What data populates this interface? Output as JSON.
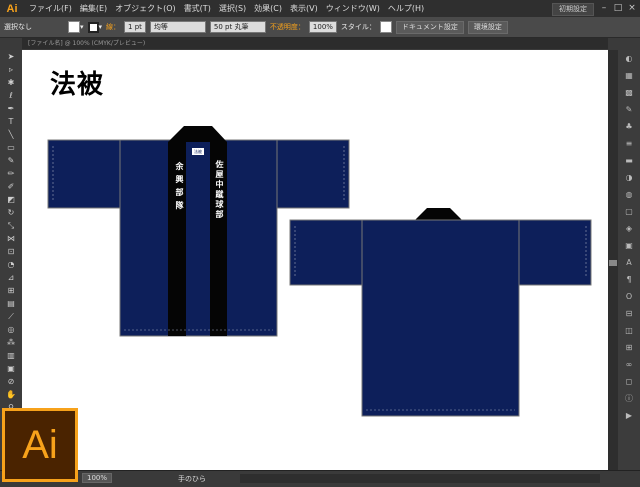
{
  "app": {
    "logo_text": "Ai",
    "brand_color": "#f7a21b"
  },
  "menubar": {
    "items": [
      "ファイル(F)",
      "編集(E)",
      "オブジェクト(O)",
      "書式(T)",
      "選択(S)",
      "効果(C)",
      "表示(V)",
      "ウィンドウ(W)",
      "ヘルプ(H)"
    ],
    "workspace": "初期設定",
    "window_buttons": [
      "–",
      "□",
      "×"
    ]
  },
  "controlbar": {
    "selection_label": "選択なし",
    "stroke_label": "線：",
    "stroke_value": "1 pt",
    "stroke_style": "均等",
    "brush_value": "50 pt 丸筆",
    "opacity_label": "不透明度：",
    "opacity_value": "100%",
    "style_label": "スタイル：",
    "doc_settings_button": "ドキュメント設定",
    "prefs_button": "環境設定"
  },
  "tab": {
    "label": "[ファイル名] @ 100% (CMYK/プレビュー)"
  },
  "artboard": {
    "title": "法被",
    "front_left_text": "余興部隊",
    "front_right_text": "佐屋中蹴球部",
    "label_tag": "法被",
    "colors": {
      "body": "#0d1f5a",
      "collar": "#000000",
      "stitch": "#9aa3b8"
    }
  },
  "statusbar": {
    "zoom": "100%",
    "tool_name": "手のひら"
  },
  "toolbar": {
    "icons": [
      "selection-tool-icon",
      "direct-selection-icon",
      "magic-wand-icon",
      "lasso-icon",
      "pen-icon",
      "type-icon",
      "line-icon",
      "rectangle-icon",
      "paintbrush-icon",
      "pencil-icon",
      "blob-brush-icon",
      "eraser-icon",
      "rotate-icon",
      "scale-icon",
      "width-icon",
      "free-transform-icon",
      "shape-builder-icon",
      "perspective-icon",
      "mesh-icon",
      "gradient-icon",
      "eyedropper-icon",
      "blend-icon",
      "symbol-sprayer-icon",
      "graph-icon",
      "artboard-icon",
      "slice-icon",
      "hand-icon",
      "zoom-icon",
      "fill-stroke-icon"
    ]
  },
  "panel_icons": [
    "color-panel-icon",
    "color-guide-icon",
    "swatches-icon",
    "brushes-icon",
    "symbols-icon",
    "stroke-icon",
    "gradient-panel-icon",
    "transparency-icon",
    "appearance-icon",
    "graphic-styles-icon",
    "layers-icon",
    "artboards-icon",
    "character-icon",
    "paragraph-icon",
    "opentype-icon",
    "align-icon",
    "pathfinder-icon",
    "transform-icon",
    "links-icon",
    "navigator-icon",
    "info-icon",
    "actions-icon"
  ]
}
